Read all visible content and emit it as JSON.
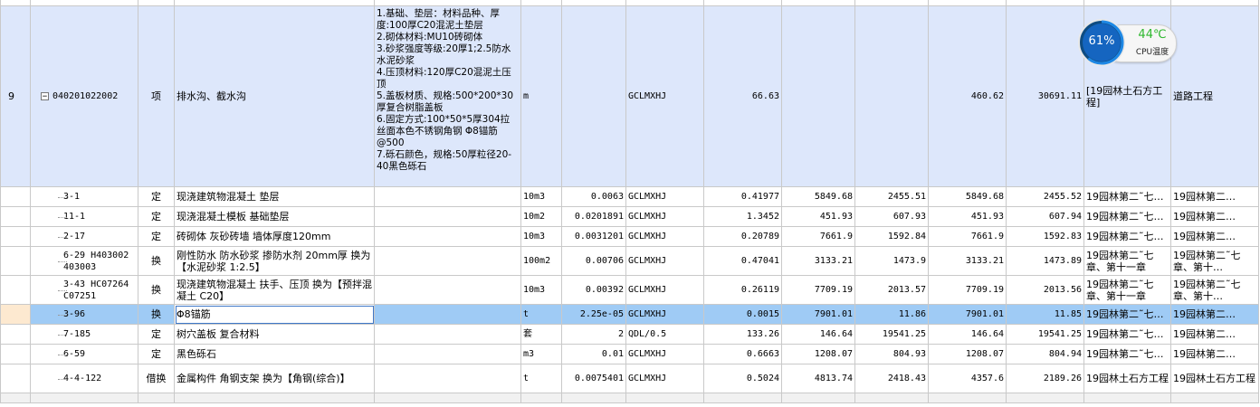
{
  "top_row": {
    "cells": [
      "",
      "",
      "",
      "",
      "",
      "",
      "",
      "",
      "",
      "",
      "",
      "",
      "",
      "",
      ""
    ]
  },
  "parent_row": {
    "index": "9",
    "code": "040201022002",
    "type": "项",
    "name": "排水沟、截水沟",
    "description": [
      "1.基础、垫层：材料品种、厚度:100厚C20混泥土垫层",
      "2.砌体材料:MU10砖砌体",
      "3.砂浆强度等级:20厚1;2.5防水水泥砂浆",
      "4.压顶材料:120厚C20混泥土压顶",
      "5.盖板材质、规格:500*200*30厚复合树脂盖板",
      "6.固定方式:100*50*5厚304拉丝面本色不锈钢角钢 Φ8锚筋@500",
      "7.砾石颜色，规格:50厚粒径20-40黑色砾石"
    ],
    "unit": "m",
    "content_ratio": "",
    "formula": "GCLMXHJ",
    "quantity": "66.63",
    "col_a": "",
    "col_b": "",
    "col_c": "460.62",
    "col_d": "30691.11",
    "source": "[19园林土石方工程]",
    "profession": "道路工程"
  },
  "rows": [
    {
      "code": "3-1",
      "type": "定",
      "name": "现浇建筑物混凝土 垫层",
      "unit": "10m3",
      "ratio": "0.0063",
      "formula": "GCLMXHJ",
      "qty": "0.41977",
      "a": "5849.68",
      "b": "2455.51",
      "c": "5849.68",
      "d": "2455.52",
      "source": "19园林第二˜七…",
      "prof": "19园林第二…"
    },
    {
      "code": "11-1",
      "type": "定",
      "name": "现浇混凝土模板 基础垫层",
      "unit": "10m2",
      "ratio": "0.0201891",
      "formula": "GCLMXHJ",
      "qty": "1.3452",
      "a": "451.93",
      "b": "607.93",
      "c": "451.93",
      "d": "607.94",
      "source": "19园林第二˜七…",
      "prof": "19园林第二…"
    },
    {
      "code": "2-17",
      "type": "定",
      "name": "砖砌体 灰砂砖墙 墙体厚度120mm",
      "unit": "10m3",
      "ratio": "0.0031201",
      "formula": "GCLMXHJ",
      "qty": "0.20789",
      "a": "7661.9",
      "b": "1592.84",
      "c": "7661.9",
      "d": "1592.83",
      "source": "19园林第二˜七…",
      "prof": "19园林第二…"
    },
    {
      "code": "6-29 H403002 403003",
      "type": "换",
      "name": "刚性防水 防水砂浆 掺防水剂 20mm厚 换为【水泥砂浆 1:2.5】",
      "unit": "100m2",
      "ratio": "0.00706",
      "formula": "GCLMXHJ",
      "qty": "0.47041",
      "a": "3133.21",
      "b": "1473.9",
      "c": "3133.21",
      "d": "1473.89",
      "source": "19园林第二˜七章、第十一章",
      "prof": "19园林第二˜七章、第十…"
    },
    {
      "code": "3-43 HC07264 C07251",
      "type": "换",
      "name": "现浇建筑物混凝土 扶手、压顶  换为【预拌混凝土 C20】",
      "unit": "10m3",
      "ratio": "0.00392",
      "formula": "GCLMXHJ",
      "qty": "0.26119",
      "a": "7709.19",
      "b": "2013.57",
      "c": "7709.19",
      "d": "2013.56",
      "source": "19园林第二˜七章、第十一章",
      "prof": "19园林第二˜七章、第十…"
    },
    {
      "code": "3-96",
      "type": "换",
      "name": "Φ8锚筋",
      "unit": "t",
      "ratio": "2.25e-05",
      "formula": "GCLMXHJ",
      "qty": "0.0015",
      "a": "7901.01",
      "b": "11.86",
      "c": "7901.01",
      "d": "11.85",
      "source": "19园林第二˜七…",
      "prof": "19园林第二…",
      "selected": true
    },
    {
      "code": "7-185",
      "type": "定",
      "name": "树穴盖板 复合材料",
      "unit": "套",
      "ratio": "2",
      "formula": "QDL/0.5",
      "qty": "133.26",
      "a": "146.64",
      "b": "19541.25",
      "c": "146.64",
      "d": "19541.25",
      "source": "19园林第二˜七…",
      "prof": "19园林第二…"
    },
    {
      "code": "6-59",
      "type": "定",
      "name": "黑色砾石",
      "unit": "m3",
      "ratio": "0.01",
      "formula": "GCLMXHJ",
      "qty": "0.6663",
      "a": "1208.07",
      "b": "804.93",
      "c": "1208.07",
      "d": "804.94",
      "source": "19园林第二˜七…",
      "prof": "19园林第二…"
    },
    {
      "code": "4-4-122",
      "type": "借换",
      "name": "金属构件 角钢支架  换为【角钢(综合)】",
      "unit": "t",
      "ratio": "0.0075401",
      "formula": "GCLMXHJ",
      "qty": "0.5024",
      "a": "4813.74",
      "b": "2418.43",
      "c": "4357.6",
      "d": "2189.26",
      "source": "19园林土石方工程",
      "prof": "19园林土石方工程"
    }
  ],
  "cpu_widget": {
    "percent": "61%",
    "percent_value": 0.61,
    "temperature": "44℃",
    "label": "CPU温度",
    "ring_color": "#1e88e5",
    "temp_color": "#2eb82e"
  }
}
